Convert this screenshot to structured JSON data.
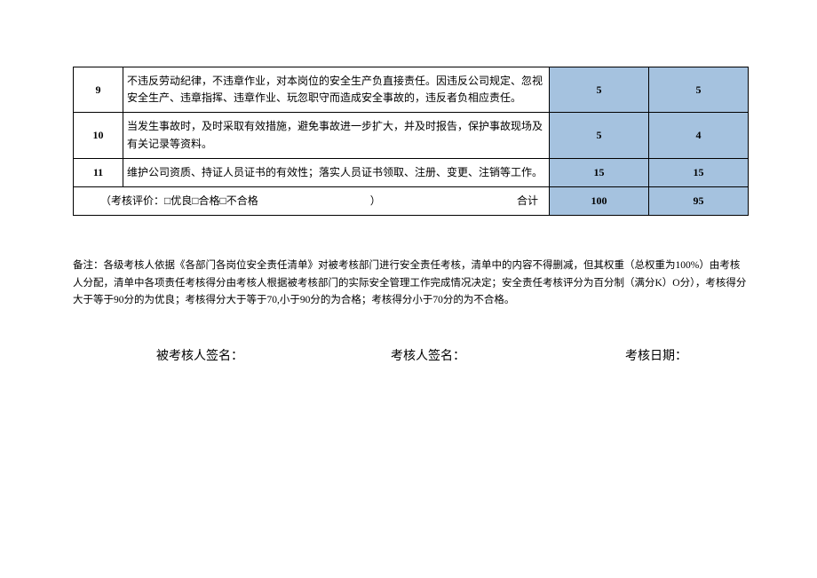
{
  "table": {
    "rows": [
      {
        "idx": "9",
        "desc": "不违反劳动纪律，不违章作业，对本岗位的安全生产负直接责任。因违反公司规定、忽视安全生产、违章指挥、违章作业、玩忽职守而造成安全事故的，违反者负相应责任。",
        "weight": "5",
        "score": "5"
      },
      {
        "idx": "10",
        "desc": "当发生事故时，及时采取有效措施，避免事故进一步扩大，并及时报告，保护事故现场及有关记录等资料。",
        "weight": "5",
        "score": "4"
      },
      {
        "idx": "11",
        "desc": "维护公司资质、持证人员证书的有效性；落实人员证书领取、注册、变更、注销等工作。",
        "weight": "15",
        "score": "15"
      }
    ],
    "summary": {
      "label_left": "（考核评价：□优良□合格□不合格",
      "label_close": "）",
      "label_right": "合计",
      "total_weight": "100",
      "total_score": "95"
    }
  },
  "note": "备注：各级考核人依据《各部门各岗位安全责任清单》对被考核部门进行安全责任考核，清单中的内容不得删减，但其权重（总权重为100%）由考核人分配，清单中各项责任考核得分由考核人根据被考核部门的实际安全管理工作完成情况决定；安全责任考核评分为百分制（满分K）O分），考核得分大于等于90分的为优良；考核得分大于等于70,小于90分的为合格；考核得分小于70分的为不合格。",
  "sign": {
    "a": "被考核人签名：",
    "b": "考核人签名：",
    "c": "考核日期："
  }
}
